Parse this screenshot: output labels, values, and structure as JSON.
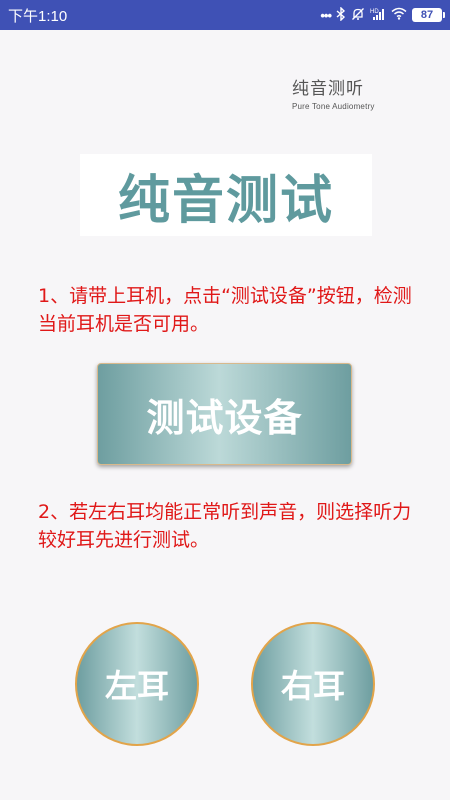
{
  "status_bar": {
    "time": "下午1:10",
    "icons": {
      "dots": "•••",
      "bluetooth": "bluetooth-icon",
      "mute": "bell-off-icon",
      "signal": "signal-icon",
      "signal_label": "HD",
      "wifi": "wifi-icon"
    },
    "battery": "87"
  },
  "brand": {
    "title": "纯音测听",
    "subtitle": "Pure Tone Audiometry"
  },
  "banner": {
    "title": "纯音测试"
  },
  "instructions": {
    "step1": "1、请带上耳机，点击“测试设备”按钮，检测当前耳机是否可用。",
    "step2": "2、若左右耳均能正常听到声音，则选择听力较好耳先进行测试。"
  },
  "buttons": {
    "test_device": "测试设备",
    "left_ear": "左耳",
    "right_ear": "右耳"
  },
  "colors": {
    "status_bar": "#3f51b5",
    "accent_teal": "#5f9a9e",
    "instruction_red": "#e01818",
    "button_border_orange": "#e2a44a"
  }
}
